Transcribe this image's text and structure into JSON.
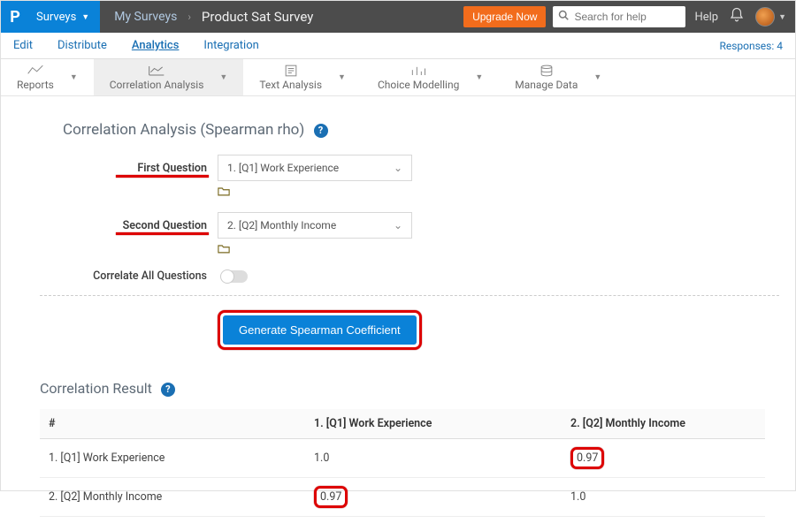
{
  "topbar": {
    "brand_letter": "P",
    "surveys_label": "Surveys",
    "breadcrumb_root": "My Surveys",
    "breadcrumb_current": "Product Sat Survey",
    "upgrade_label": "Upgrade Now",
    "search_placeholder": "Search for help",
    "help_label": "Help"
  },
  "mainnav": {
    "items": [
      "Edit",
      "Distribute",
      "Analytics",
      "Integration"
    ],
    "active_index": 2,
    "responses_label": "Responses: 4"
  },
  "tools": {
    "items": [
      {
        "label": "Reports"
      },
      {
        "label": "Correlation Analysis"
      },
      {
        "label": "Text Analysis"
      },
      {
        "label": "Choice Modelling"
      },
      {
        "label": "Manage Data"
      }
    ],
    "active_index": 1
  },
  "correlation": {
    "title": "Correlation Analysis (Spearman rho)",
    "first_label": "First Question",
    "first_value": "1. [Q1] Work Experience",
    "second_label": "Second Question",
    "second_value": "2. [Q2] Monthly Income",
    "correlate_all_label": "Correlate All Questions",
    "correlate_all_on": false,
    "generate_label": "Generate Spearman Coefficient"
  },
  "result": {
    "title": "Correlation Result",
    "headers": [
      "#",
      "1. [Q1] Work Experience",
      "2. [Q2] Monthly Income"
    ],
    "rows": [
      {
        "label": "1. [Q1] Work Experience",
        "cells": [
          "1.0",
          "0.97"
        ],
        "highlight_index": 1
      },
      {
        "label": "2. [Q2] Monthly Income",
        "cells": [
          "0.97",
          "1.0"
        ],
        "highlight_index": 0
      }
    ]
  },
  "chart_data": {
    "type": "table",
    "title": "Correlation Result (Spearman rho)",
    "row_labels": [
      "1. [Q1] Work Experience",
      "2. [Q2] Monthly Income"
    ],
    "col_labels": [
      "1. [Q1] Work Experience",
      "2. [Q2] Monthly Income"
    ],
    "matrix": [
      [
        1.0,
        0.97
      ],
      [
        0.97,
        1.0
      ]
    ]
  }
}
